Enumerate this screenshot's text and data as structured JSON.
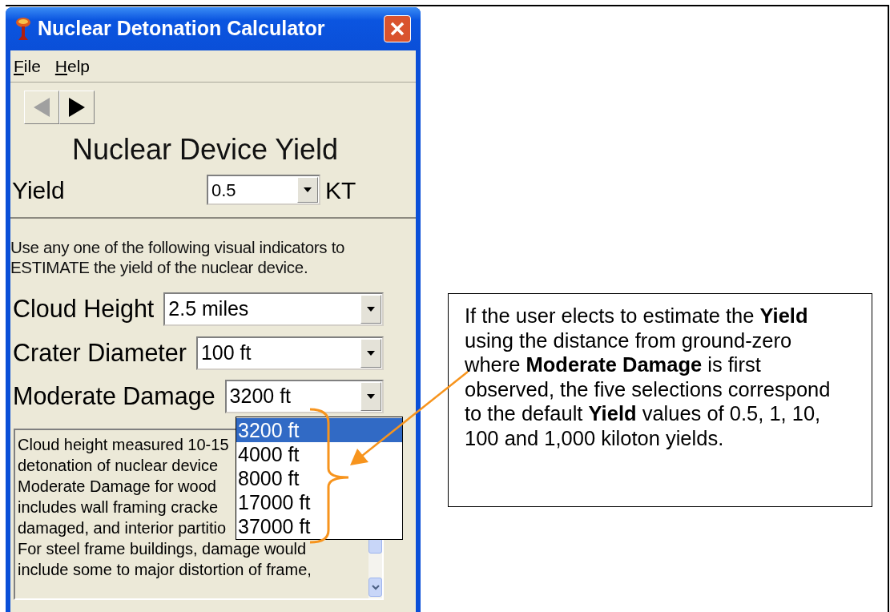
{
  "window": {
    "title": "Nuclear Detonation Calculator"
  },
  "menu": [
    {
      "label": "File"
    },
    {
      "label": "Help"
    }
  ],
  "nav": [
    {
      "kind": "back",
      "disabled": true
    },
    {
      "kind": "forward",
      "disabled": false
    }
  ],
  "heading": "Nuclear Device Yield",
  "yield": {
    "label": "Yield",
    "value": "0.5",
    "unit": "KT"
  },
  "instructions": "Use any one of the following visual indicators to\nESTIMATE the yield of the nuclear device.",
  "indicators": [
    {
      "label": "Cloud Height",
      "value": "2.5 miles"
    },
    {
      "label": "Crater Diameter",
      "value": "100 ft"
    },
    {
      "label": "Moderate Damage",
      "value": "3200 ft"
    }
  ],
  "notes": [
    "Cloud height measured 10-15",
    "detonation of nuclear device",
    "Moderate Damage for wood",
    "includes wall framing cracke",
    "damaged, and interior partitio",
    "For steel frame buildings, damage would",
    "include some to major distortion of frame,"
  ],
  "dropdown_options": [
    {
      "label": "3200 ft",
      "selected": true
    },
    {
      "label": "4000 ft",
      "selected": false
    },
    {
      "label": "8000 ft",
      "selected": false
    },
    {
      "label": "17000 ft",
      "selected": false
    },
    {
      "label": "37000 ft",
      "selected": false
    }
  ],
  "callout": {
    "text": "If the user elects to estimate the **Yield**\nusing the distance from ground-zero\nwhere **Moderate Damage** is first\nobserved, the five selections correspond\nto the default **Yield** values of 0.5, 1, 10,\n100 and 1,000 kiloton yields."
  }
}
